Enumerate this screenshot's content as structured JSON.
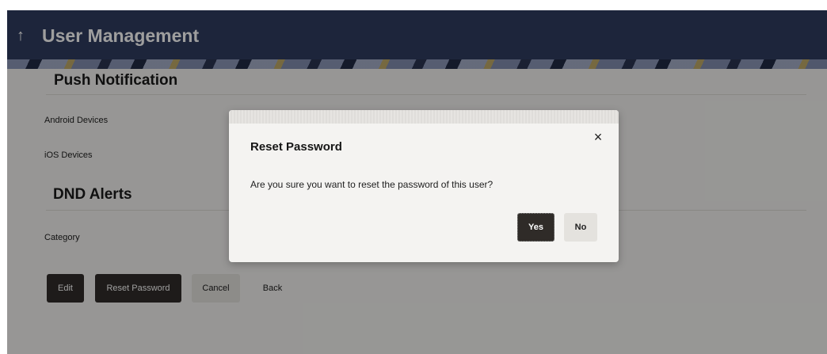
{
  "header": {
    "back_icon": "↑",
    "title": "User Management"
  },
  "sections": {
    "push_notification": {
      "title": "Push Notification",
      "android_label": "Android Devices",
      "ios_label": "iOS Devices"
    },
    "dnd_alerts": {
      "title": "DND Alerts",
      "category_label": "Category"
    }
  },
  "actions": {
    "edit": "Edit",
    "reset_password": "Reset Password",
    "cancel": "Cancel",
    "back": "Back"
  },
  "modal": {
    "title": "Reset Password",
    "close_icon": "×",
    "message": "Are you sure you want to reset the password of this user?",
    "yes": "Yes",
    "no": "No"
  }
}
